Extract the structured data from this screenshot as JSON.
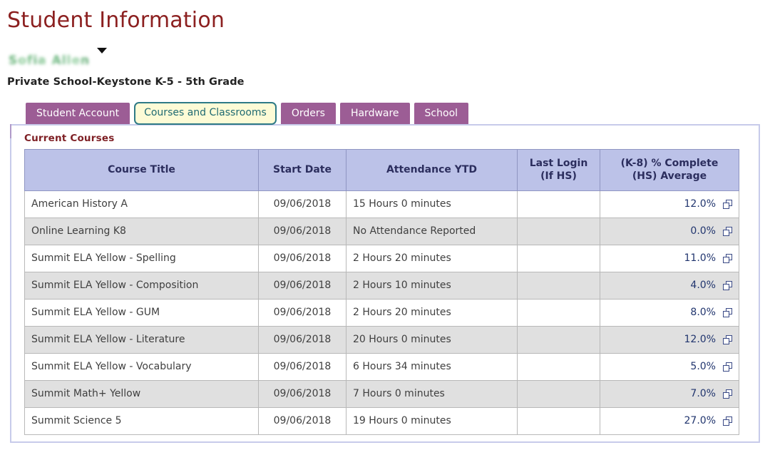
{
  "page": {
    "title": "Student Information",
    "student_name": "Sofia Allen",
    "student_dropdown_icon": "caret-down-icon",
    "school_line": "Private School-Keystone K-5 - 5th Grade"
  },
  "tabs": [
    {
      "label": "Student Account",
      "active": false
    },
    {
      "label": "Courses and Classrooms",
      "active": true
    },
    {
      "label": "Orders",
      "active": false
    },
    {
      "label": "Hardware",
      "active": false
    },
    {
      "label": "School",
      "active": false
    }
  ],
  "section": {
    "label": "Current Courses"
  },
  "table": {
    "columns": [
      "Course Title",
      "Start Date",
      "Attendance YTD",
      "Last Login\n(If HS)",
      "(K-8) % Complete\n(HS) Average"
    ],
    "columns_multiline": [
      {
        "line1": "Course Title",
        "line2": ""
      },
      {
        "line1": "Start Date",
        "line2": ""
      },
      {
        "line1": "Attendance YTD",
        "line2": ""
      },
      {
        "line1": "Last Login",
        "line2": "(If HS)"
      },
      {
        "line1": "(K-8) % Complete",
        "line2": "(HS) Average"
      }
    ],
    "rows": [
      {
        "course_title": "American History A",
        "start_date": "09/06/2018",
        "attendance": "15 Hours 0 minutes",
        "attendance_missing": false,
        "last_login": "",
        "percent": "12.0%",
        "open_icon": "open-in-new-window-icon"
      },
      {
        "course_title": "Online Learning K8",
        "start_date": "09/06/2018",
        "attendance": "No Attendance Reported",
        "attendance_missing": true,
        "last_login": "",
        "percent": "0.0%",
        "open_icon": "open-in-new-window-icon"
      },
      {
        "course_title": "Summit ELA Yellow - Spelling",
        "start_date": "09/06/2018",
        "attendance": "2 Hours 20 minutes",
        "attendance_missing": false,
        "last_login": "",
        "percent": "11.0%",
        "open_icon": "open-in-new-window-icon"
      },
      {
        "course_title": "Summit ELA Yellow - Composition",
        "start_date": "09/06/2018",
        "attendance": "2 Hours 10 minutes",
        "attendance_missing": false,
        "last_login": "",
        "percent": "4.0%",
        "open_icon": "open-in-new-window-icon"
      },
      {
        "course_title": "Summit ELA Yellow - GUM",
        "start_date": "09/06/2018",
        "attendance": "2 Hours 20 minutes",
        "attendance_missing": false,
        "last_login": "",
        "percent": "8.0%",
        "open_icon": "open-in-new-window-icon"
      },
      {
        "course_title": "Summit ELA Yellow - Literature",
        "start_date": "09/06/2018",
        "attendance": "20 Hours 0 minutes",
        "attendance_missing": false,
        "last_login": "",
        "percent": "12.0%",
        "open_icon": "open-in-new-window-icon"
      },
      {
        "course_title": "Summit ELA Yellow - Vocabulary",
        "start_date": "09/06/2018",
        "attendance": "6 Hours 34 minutes",
        "attendance_missing": false,
        "last_login": "",
        "percent": "5.0%",
        "open_icon": "open-in-new-window-icon"
      },
      {
        "course_title": "Summit Math+ Yellow",
        "start_date": "09/06/2018",
        "attendance": "7 Hours 0 minutes",
        "attendance_missing": false,
        "last_login": "",
        "percent": "7.0%",
        "open_icon": "open-in-new-window-icon"
      },
      {
        "course_title": "Summit Science 5",
        "start_date": "09/06/2018",
        "attendance": "19 Hours 0 minutes",
        "attendance_missing": false,
        "last_login": "",
        "percent": "27.0%",
        "open_icon": "open-in-new-window-icon"
      }
    ]
  },
  "colors": {
    "title": "#8c2020",
    "tab_inactive_bg": "#9c5d95",
    "tab_active_bg": "#fdfbd6",
    "tab_active_border": "#2e7a86",
    "table_header_bg": "#bcc2e8",
    "panel_border": "#c7cbea",
    "percent_text": "#21356e",
    "no_attendance_text": "#e8615e",
    "row_alt_bg": "#e0e0e0"
  }
}
